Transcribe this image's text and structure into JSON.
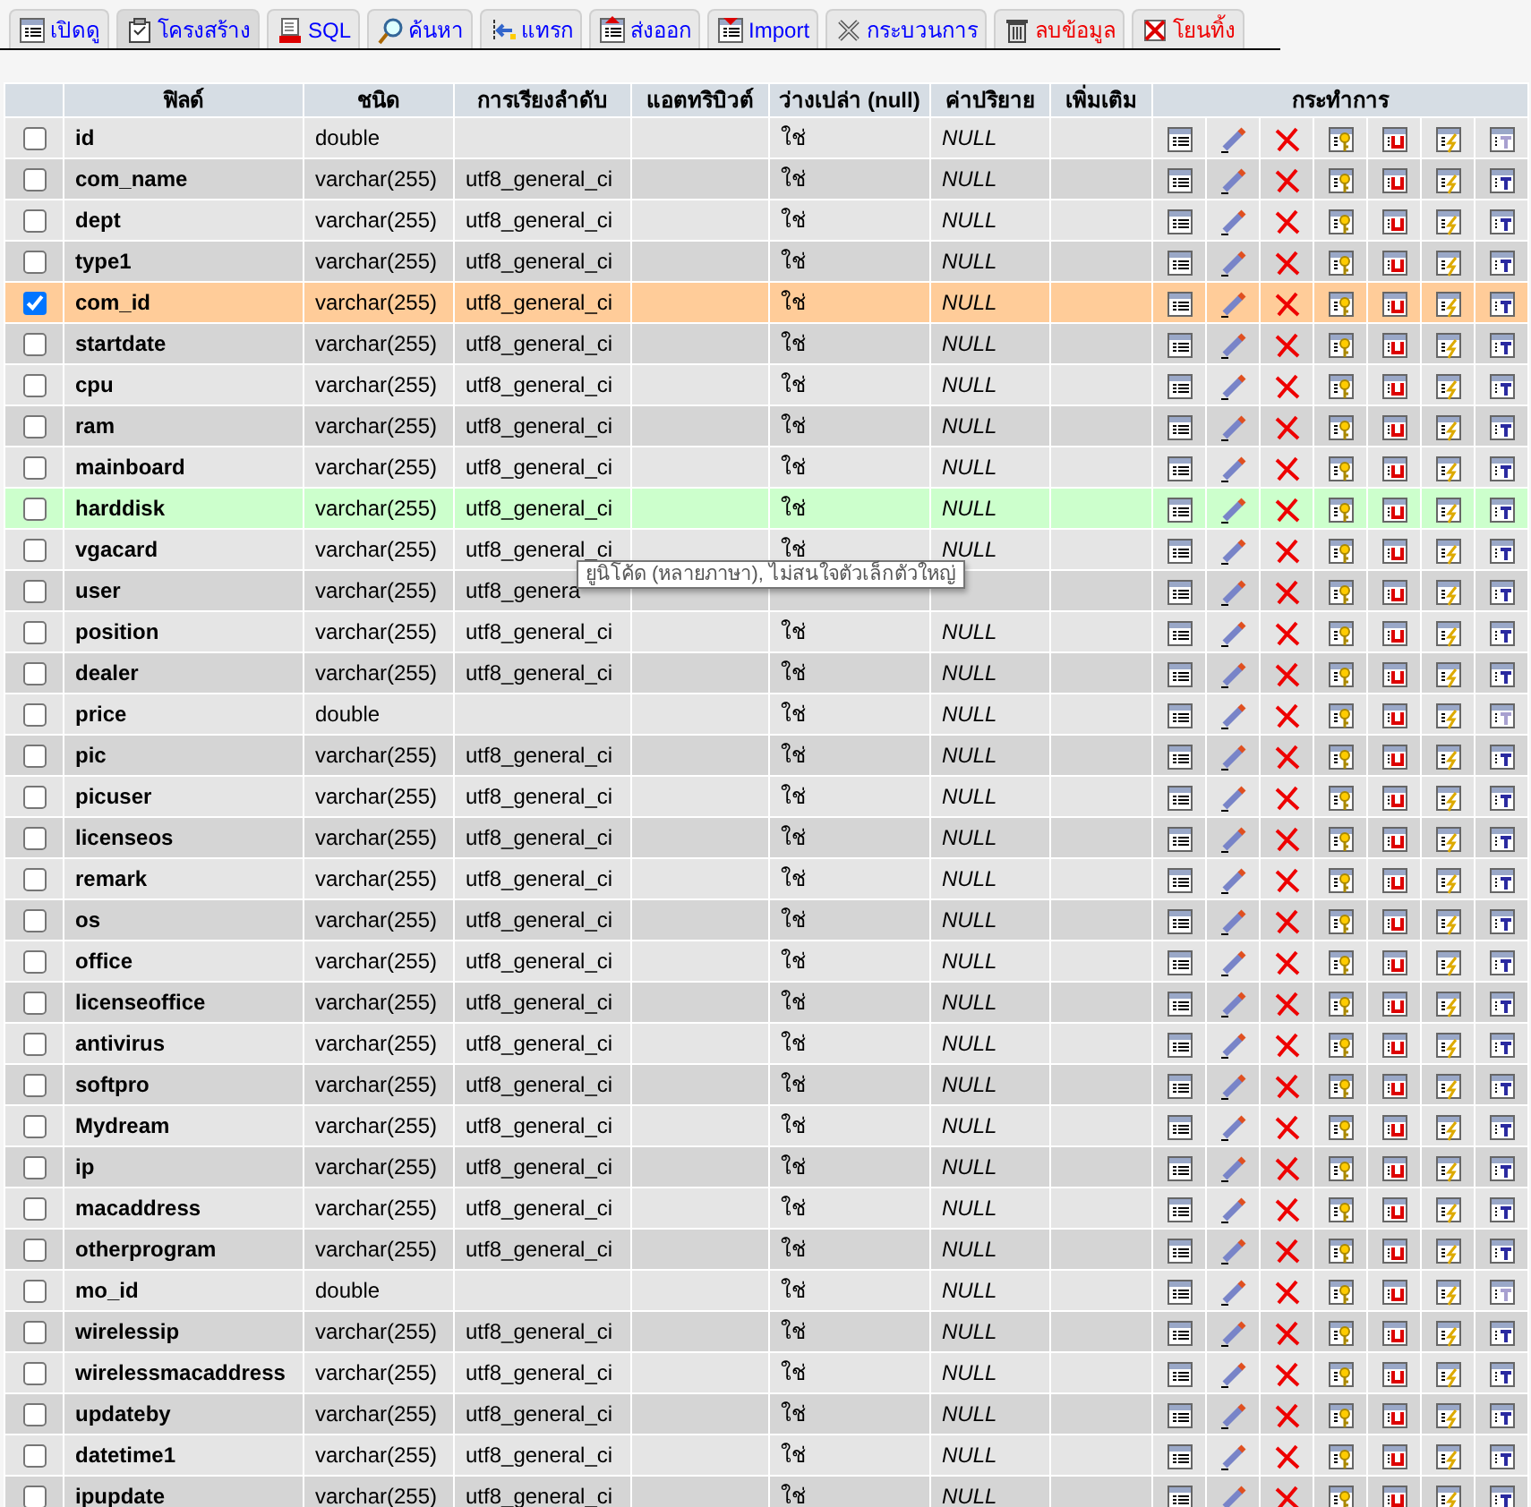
{
  "tabs": [
    {
      "label": "เปิดดู",
      "selected": false,
      "danger": false
    },
    {
      "label": "โครงสร้าง",
      "selected": true,
      "danger": false
    },
    {
      "label": "SQL",
      "selected": false,
      "danger": false
    },
    {
      "label": "ค้นหา",
      "selected": false,
      "danger": false
    },
    {
      "label": "แทรก",
      "selected": false,
      "danger": false
    },
    {
      "label": "ส่งออก",
      "selected": false,
      "danger": false
    },
    {
      "label": "Import",
      "selected": false,
      "danger": false
    },
    {
      "label": "กระบวนการ",
      "selected": false,
      "danger": false
    },
    {
      "label": "ลบข้อมูล",
      "selected": false,
      "danger": true
    },
    {
      "label": "โยนทิ้ง",
      "selected": false,
      "danger": true
    }
  ],
  "table": {
    "columns": [
      "ฟิลด์",
      "ชนิด",
      "การเรียงลำดับ",
      "แอตทริบิวต์",
      "ว่างเปล่า (null)",
      "ค่าปริยาย",
      "เพิ่มเติม",
      "กระทำการ"
    ],
    "rows": [
      {
        "field": "id",
        "type": "double",
        "collation": "",
        "null": "ใช่",
        "default": "NULL",
        "checked": false,
        "selected": false,
        "hovered": false,
        "fulltext_enabled": false
      },
      {
        "field": "com_name",
        "type": "varchar(255)",
        "collation": "utf8_general_ci",
        "null": "ใช่",
        "default": "NULL",
        "checked": false,
        "selected": false,
        "hovered": false,
        "fulltext_enabled": true
      },
      {
        "field": "dept",
        "type": "varchar(255)",
        "collation": "utf8_general_ci",
        "null": "ใช่",
        "default": "NULL",
        "checked": false,
        "selected": false,
        "hovered": false,
        "fulltext_enabled": true
      },
      {
        "field": "type1",
        "type": "varchar(255)",
        "collation": "utf8_general_ci",
        "null": "ใช่",
        "default": "NULL",
        "checked": false,
        "selected": false,
        "hovered": false,
        "fulltext_enabled": true
      },
      {
        "field": "com_id",
        "type": "varchar(255)",
        "collation": "utf8_general_ci",
        "null": "ใช่",
        "default": "NULL",
        "checked": true,
        "selected": true,
        "hovered": false,
        "fulltext_enabled": true
      },
      {
        "field": "startdate",
        "type": "varchar(255)",
        "collation": "utf8_general_ci",
        "null": "ใช่",
        "default": "NULL",
        "checked": false,
        "selected": false,
        "hovered": false,
        "fulltext_enabled": true
      },
      {
        "field": "cpu",
        "type": "varchar(255)",
        "collation": "utf8_general_ci",
        "null": "ใช่",
        "default": "NULL",
        "checked": false,
        "selected": false,
        "hovered": false,
        "fulltext_enabled": true
      },
      {
        "field": "ram",
        "type": "varchar(255)",
        "collation": "utf8_general_ci",
        "null": "ใช่",
        "default": "NULL",
        "checked": false,
        "selected": false,
        "hovered": false,
        "fulltext_enabled": true
      },
      {
        "field": "mainboard",
        "type": "varchar(255)",
        "collation": "utf8_general_ci",
        "null": "ใช่",
        "default": "NULL",
        "checked": false,
        "selected": false,
        "hovered": false,
        "fulltext_enabled": true
      },
      {
        "field": "harddisk",
        "type": "varchar(255)",
        "collation": "utf8_general_ci",
        "null": "ใช่",
        "default": "NULL",
        "checked": false,
        "selected": false,
        "hovered": true,
        "fulltext_enabled": true
      },
      {
        "field": "vgacard",
        "type": "varchar(255)",
        "collation": "utf8_general_ci",
        "null": "ใช่",
        "default": "NULL",
        "checked": false,
        "selected": false,
        "hovered": false,
        "fulltext_enabled": true
      },
      {
        "field": "user",
        "type": "varchar(255)",
        "collation": "utf8_genera",
        "checked": false,
        "selected": false,
        "hovered": false,
        "fulltext_enabled": true
      },
      {
        "field": "position",
        "type": "varchar(255)",
        "collation": "utf8_general_ci",
        "null": "ใช่",
        "default": "NULL",
        "checked": false,
        "selected": false,
        "hovered": false,
        "fulltext_enabled": true
      },
      {
        "field": "dealer",
        "type": "varchar(255)",
        "collation": "utf8_general_ci",
        "null": "ใช่",
        "default": "NULL",
        "checked": false,
        "selected": false,
        "hovered": false,
        "fulltext_enabled": true
      },
      {
        "field": "price",
        "type": "double",
        "collation": "",
        "null": "ใช่",
        "default": "NULL",
        "checked": false,
        "selected": false,
        "hovered": false,
        "fulltext_enabled": false
      },
      {
        "field": "pic",
        "type": "varchar(255)",
        "collation": "utf8_general_ci",
        "null": "ใช่",
        "default": "NULL",
        "checked": false,
        "selected": false,
        "hovered": false,
        "fulltext_enabled": true
      },
      {
        "field": "picuser",
        "type": "varchar(255)",
        "collation": "utf8_general_ci",
        "null": "ใช่",
        "default": "NULL",
        "checked": false,
        "selected": false,
        "hovered": false,
        "fulltext_enabled": true
      },
      {
        "field": "licenseos",
        "type": "varchar(255)",
        "collation": "utf8_general_ci",
        "null": "ใช่",
        "default": "NULL",
        "checked": false,
        "selected": false,
        "hovered": false,
        "fulltext_enabled": true
      },
      {
        "field": "remark",
        "type": "varchar(255)",
        "collation": "utf8_general_ci",
        "null": "ใช่",
        "default": "NULL",
        "checked": false,
        "selected": false,
        "hovered": false,
        "fulltext_enabled": true
      },
      {
        "field": "os",
        "type": "varchar(255)",
        "collation": "utf8_general_ci",
        "null": "ใช่",
        "default": "NULL",
        "checked": false,
        "selected": false,
        "hovered": false,
        "fulltext_enabled": true
      },
      {
        "field": "office",
        "type": "varchar(255)",
        "collation": "utf8_general_ci",
        "null": "ใช่",
        "default": "NULL",
        "checked": false,
        "selected": false,
        "hovered": false,
        "fulltext_enabled": true
      },
      {
        "field": "licenseoffice",
        "type": "varchar(255)",
        "collation": "utf8_general_ci",
        "null": "ใช่",
        "default": "NULL",
        "checked": false,
        "selected": false,
        "hovered": false,
        "fulltext_enabled": true
      },
      {
        "field": "antivirus",
        "type": "varchar(255)",
        "collation": "utf8_general_ci",
        "null": "ใช่",
        "default": "NULL",
        "checked": false,
        "selected": false,
        "hovered": false,
        "fulltext_enabled": true
      },
      {
        "field": "softpro",
        "type": "varchar(255)",
        "collation": "utf8_general_ci",
        "null": "ใช่",
        "default": "NULL",
        "checked": false,
        "selected": false,
        "hovered": false,
        "fulltext_enabled": true
      },
      {
        "field": "Mydream",
        "type": "varchar(255)",
        "collation": "utf8_general_ci",
        "null": "ใช่",
        "default": "NULL",
        "checked": false,
        "selected": false,
        "hovered": false,
        "fulltext_enabled": true
      },
      {
        "field": "ip",
        "type": "varchar(255)",
        "collation": "utf8_general_ci",
        "null": "ใช่",
        "default": "NULL",
        "checked": false,
        "selected": false,
        "hovered": false,
        "fulltext_enabled": true
      },
      {
        "field": "macaddress",
        "type": "varchar(255)",
        "collation": "utf8_general_ci",
        "null": "ใช่",
        "default": "NULL",
        "checked": false,
        "selected": false,
        "hovered": false,
        "fulltext_enabled": true
      },
      {
        "field": "otherprogram",
        "type": "varchar(255)",
        "collation": "utf8_general_ci",
        "null": "ใช่",
        "default": "NULL",
        "checked": false,
        "selected": false,
        "hovered": false,
        "fulltext_enabled": true
      },
      {
        "field": "mo_id",
        "type": "double",
        "collation": "",
        "null": "ใช่",
        "default": "NULL",
        "checked": false,
        "selected": false,
        "hovered": false,
        "fulltext_enabled": false
      },
      {
        "field": "wirelessip",
        "type": "varchar(255)",
        "collation": "utf8_general_ci",
        "null": "ใช่",
        "default": "NULL",
        "checked": false,
        "selected": false,
        "hovered": false,
        "fulltext_enabled": true
      },
      {
        "field": "wirelessmacaddress",
        "type": "varchar(255)",
        "collation": "utf8_general_ci",
        "null": "ใช่",
        "default": "NULL",
        "checked": false,
        "selected": false,
        "hovered": false,
        "fulltext_enabled": true
      },
      {
        "field": "updateby",
        "type": "varchar(255)",
        "collation": "utf8_general_ci",
        "null": "ใช่",
        "default": "NULL",
        "checked": false,
        "selected": false,
        "hovered": false,
        "fulltext_enabled": true
      },
      {
        "field": "datetime1",
        "type": "varchar(255)",
        "collation": "utf8_general_ci",
        "null": "ใช่",
        "default": "NULL",
        "checked": false,
        "selected": false,
        "hovered": false,
        "fulltext_enabled": true
      },
      {
        "field": "ipupdate",
        "type": "varchar(255)",
        "collation": "utf8_general_ci",
        "null": "ใช่",
        "default": "NULL",
        "checked": false,
        "selected": false,
        "hovered": false,
        "fulltext_enabled": true
      }
    ]
  },
  "tooltip": {
    "text": "ยูนิโค้ด (หลายภาษา), ไม่สนใจตัวเล็กตัวใหญ่"
  }
}
